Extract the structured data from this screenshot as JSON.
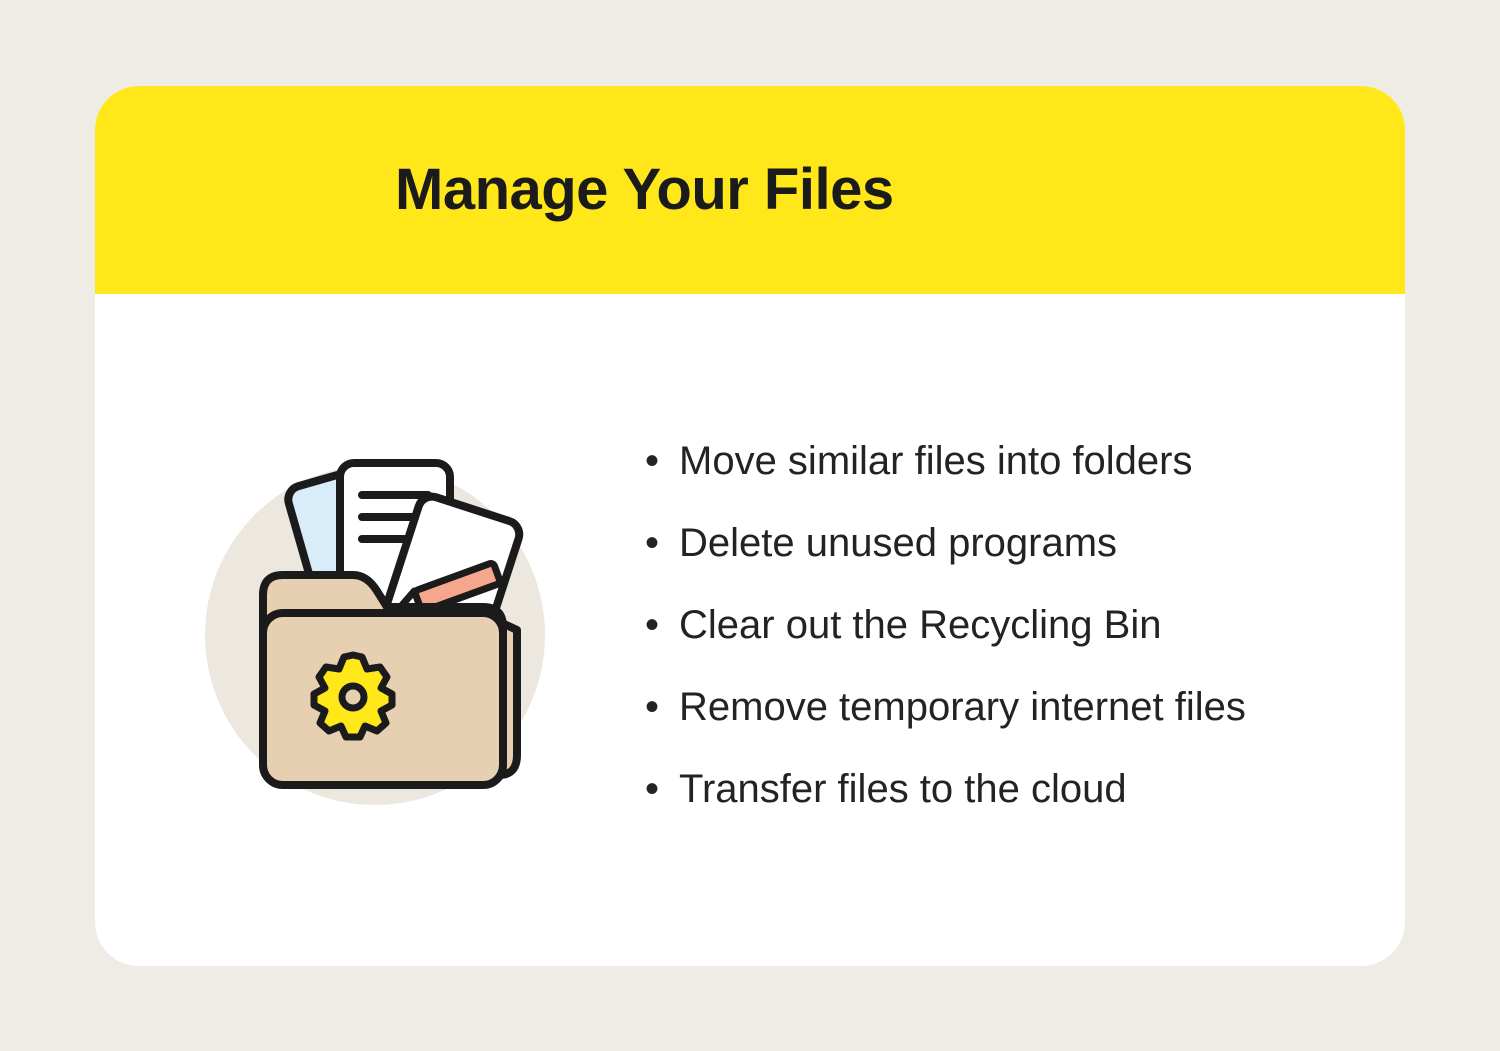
{
  "header": {
    "title": "Manage Your Files"
  },
  "illustration": {
    "name": "folder-documents-gear-icon",
    "colors": {
      "circle_bg": "#ece7df",
      "folder_fill": "#e7cfb2",
      "folder_stroke": "#1b1b1b",
      "paper_fill": "#ffffff",
      "paper_blue": "#d9ecfa",
      "pencil_fill": "#f5a78e",
      "gear_fill": "#ffe71a"
    }
  },
  "tips": [
    "Move similar files into folders",
    "Delete unused programs",
    "Clear out the Recycling Bin",
    "Remove temporary internet files",
    "Transfer files to the cloud"
  ]
}
